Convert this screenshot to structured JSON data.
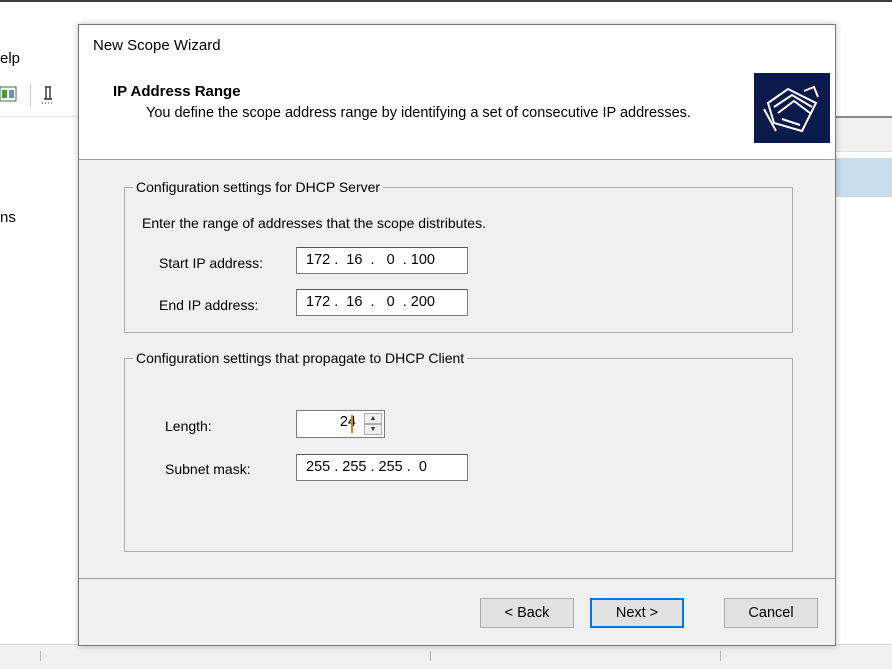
{
  "background": {
    "menu_fragment": "elp",
    "node_label_fragment": "ns"
  },
  "wizard": {
    "window_title": "New Scope Wizard",
    "header_title": "IP Address Range",
    "header_subtitle": "You define the scope address range by identifying a set of consecutive IP addresses.",
    "header_icon": "folders-icon",
    "server_group": {
      "legend": "Configuration settings for DHCP Server",
      "instruction": "Enter the range of addresses that the scope distributes.",
      "start_label": "Start IP address:",
      "start_value": "172 .  16  .   0  . 100",
      "end_label": "End IP address:",
      "end_value": "172 .  16  .   0  . 200"
    },
    "client_group": {
      "legend": "Configuration settings that propagate to DHCP Client",
      "length_label": "Length:",
      "length_value": "24",
      "mask_label": "Subnet mask:",
      "mask_value": "255 . 255 . 255 .  0"
    },
    "buttons": {
      "back": "< Back",
      "next": "Next >",
      "cancel": "Cancel"
    }
  }
}
